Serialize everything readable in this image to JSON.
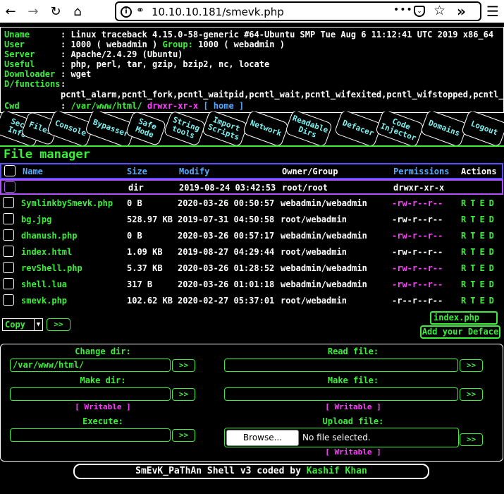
{
  "browser": {
    "url": "10.10.10.181/smevk.php",
    "url_dots": "•••",
    "icons": [
      "back-icon",
      "forward-icon",
      "reload-icon",
      "home-icon",
      "info-icon",
      "key-icon",
      "page-actions-icon",
      "pocket-icon",
      "bookmark-star-icon",
      "extensions-icon",
      "menu-icon"
    ]
  },
  "info": {
    "uname_label": "Uname",
    "uname_value": ": Linux traceback 4.15.0-58-generic #64-Ubuntu SMP Tue Aug 6 11:12:41 UTC 2019 x86_64",
    "user_label": "User",
    "user_colon": ": ",
    "user_value": "1000 ( webadmin )",
    "group_label": "Group:",
    "group_value": "1000 ( webadmin )",
    "server_label": "Server",
    "server_value": ": Apache/2.4.29 (Ubuntu)",
    "useful_label": "Useful",
    "useful_value": ": php, perl, tar, gzip, bzip2, nc, locate",
    "downloader_label": "Downloader",
    "downloader_value": ": wget",
    "dfunctions_label": "D/functions",
    "dfunctions_colon": ":",
    "dfunctions_value": "pcntl_alarm,pcntl_fork,pcntl_waitpid,pcntl_wait,pcntl_wifexited,pcntl_wifstopped,pcntl_wifsignaled,pc",
    "cwd_label": "Cwd",
    "cwd_colon": ": ",
    "cwd_value": "/var/www/html/",
    "cwd_perm": "drwxr-xr-x",
    "cwd_home": "[ home ]"
  },
  "tabs": [
    {
      "label": "Sec. Info"
    },
    {
      "label": "Files"
    },
    {
      "label": "Console"
    },
    {
      "label": "Bypasser"
    },
    {
      "label": "Safe Mode"
    },
    {
      "label": "String tools"
    },
    {
      "label": "Import Scripts"
    },
    {
      "label": "Network"
    },
    {
      "label": "Readable Dirs"
    },
    {
      "label": "Defacer"
    },
    {
      "label": "Code Injector"
    },
    {
      "label": "Domains"
    },
    {
      "label": "Logout"
    }
  ],
  "file_manager": {
    "title": "File manager",
    "headers": {
      "name": "Name",
      "size": "Size",
      "modify": "Modify",
      "owner": "Owner/Group",
      "permissions": "Permissions",
      "actions": "Actions"
    },
    "dir_row": {
      "size": "dir",
      "modify": "2019-08-24 03:42:53",
      "owner": "root/root",
      "perm": "drwxr-xr-x"
    },
    "files": [
      {
        "name": "SymlinkbySmevk.php",
        "size": "0 B",
        "modify": "2020-03-26 00:50:57",
        "owner": "webadmin/webadmin",
        "perm": "-rw-r--r--",
        "perm_color": "#ff40ff",
        "actions": "RTED"
      },
      {
        "name": "bg.jpg",
        "size": "528.97 KB",
        "modify": "2019-07-31 04:50:58",
        "owner": "root/webadmin",
        "perm": "-rw-r--r--",
        "perm_color": "#ffffff",
        "actions": "RTED"
      },
      {
        "name": "dhanush.php",
        "size": "0 B",
        "modify": "2020-03-26 00:57:17",
        "owner": "webadmin/webadmin",
        "perm": "-rw-r--r--",
        "perm_color": "#ff40ff",
        "actions": "RTED"
      },
      {
        "name": "index.html",
        "size": "1.09 KB",
        "modify": "2019-08-27 04:29:44",
        "owner": "root/webadmin",
        "perm": "-rw-r--r--",
        "perm_color": "#ffffff",
        "actions": "RTED"
      },
      {
        "name": "revShell.php",
        "size": "5.37 KB",
        "modify": "2020-03-26 01:28:52",
        "owner": "webadmin/webadmin",
        "perm": "-rw-r--r--",
        "perm_color": "#ff40ff",
        "actions": "RTED"
      },
      {
        "name": "shell.lua",
        "size": "317 B",
        "modify": "2020-03-26 01:01:18",
        "owner": "webadmin/webadmin",
        "perm": "-rw-r--r--",
        "perm_color": "#ff40ff",
        "actions": "RTED"
      },
      {
        "name": "smevk.php",
        "size": "102.62 KB",
        "modify": "2020-02-27 05:37:01",
        "owner": "root/webadmin",
        "perm": "-r--r--r--",
        "perm_color": "#ffffff",
        "actions": "RTED"
      }
    ],
    "copy_select": "Copy",
    "go_label": ">>",
    "deface_input": "index.php",
    "deface_button": "Add your Deface"
  },
  "tools": {
    "change_dir_label": "Change dir:",
    "change_dir_value": "/var/www/html/",
    "read_file_label": "Read file:",
    "make_dir_label": "Make dir:",
    "make_file_label": "Make file:",
    "writable": "[ Writable ]",
    "execute_label": "Execute:",
    "upload_label": "Upload file:",
    "browse_button": "Browse...",
    "browse_status": "No file selected.",
    "go_label": ">>"
  },
  "footer": {
    "text": "SmEvK_PaThAn Shell v3 coded by ",
    "author": "Kashif Khan"
  }
}
